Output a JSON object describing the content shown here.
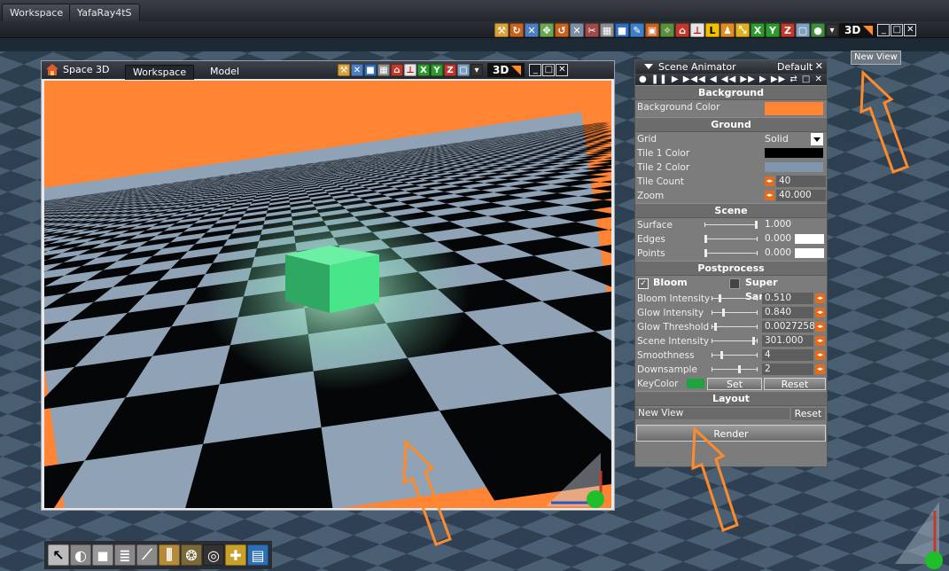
{
  "app": {
    "top_tabs": [
      "Workspace",
      "YafaRay4tS"
    ],
    "main_mode": "3D"
  },
  "space_window": {
    "title": "Space 3D",
    "tabs": [
      "Workspace",
      "Model"
    ],
    "mode": "3D",
    "background_color": "#ff8434",
    "object_color": "#3ddc78",
    "tile_dark": "#050608",
    "tile_light": "#8fa2b6"
  },
  "scene_animator": {
    "title": "Scene Animator",
    "preset": "Default",
    "transport": "● ❚❚ ▶ ▶◀◀ ◀ ◀◀ ▶▶ ▶ ▶▶ ⇄ □ ✕",
    "background": {
      "header": "Background",
      "color_label": "Background Color",
      "color": "#ff8434"
    },
    "ground": {
      "header": "Ground",
      "grid_label": "Grid",
      "grid_value": "Solid",
      "tile1_label": "Tile 1 Color",
      "tile1_color": "#000000",
      "tile2_label": "Tile 2 Color",
      "tile2_color": "#7e95ad",
      "tile_count_label": "Tile Count",
      "tile_count": "40",
      "zoom_label": "Zoom",
      "zoom": "40.000"
    },
    "scene": {
      "header": "Scene",
      "surface_label": "Surface",
      "surface": "1.000",
      "edges_label": "Edges",
      "edges": "0.000",
      "points_label": "Points",
      "points": "0.000"
    },
    "postprocess": {
      "header": "Postprocess",
      "bloom_label": "Bloom",
      "bloom_checked": true,
      "super_sampling_label": "Super Sampling",
      "super_sampling_checked": false,
      "rows": [
        {
          "label": "Bloom Intensity",
          "value": "0.510",
          "level": 0.1
        },
        {
          "label": "Glow Intensity",
          "value": "0.840",
          "level": 0.2
        },
        {
          "label": "Glow Threshold",
          "value": "0.0027258(",
          "level": 0.0
        },
        {
          "label": "Scene Intensity",
          "value": "301.000",
          "level": 0.95
        },
        {
          "label": "Smoothness",
          "value": "4",
          "level": 0.15
        },
        {
          "label": "Downsample",
          "value": "2",
          "level": 0.6
        }
      ],
      "keycolor_label": "KeyColor",
      "keycolor": "#1fa23f",
      "set_label": "Set",
      "reset_label": "Reset"
    },
    "layout": {
      "header": "Layout",
      "name": "New View",
      "reset_label": "Reset"
    },
    "render_label": "Render"
  },
  "new_view_badge": "New View",
  "annotation_color": "#ff8a2a"
}
